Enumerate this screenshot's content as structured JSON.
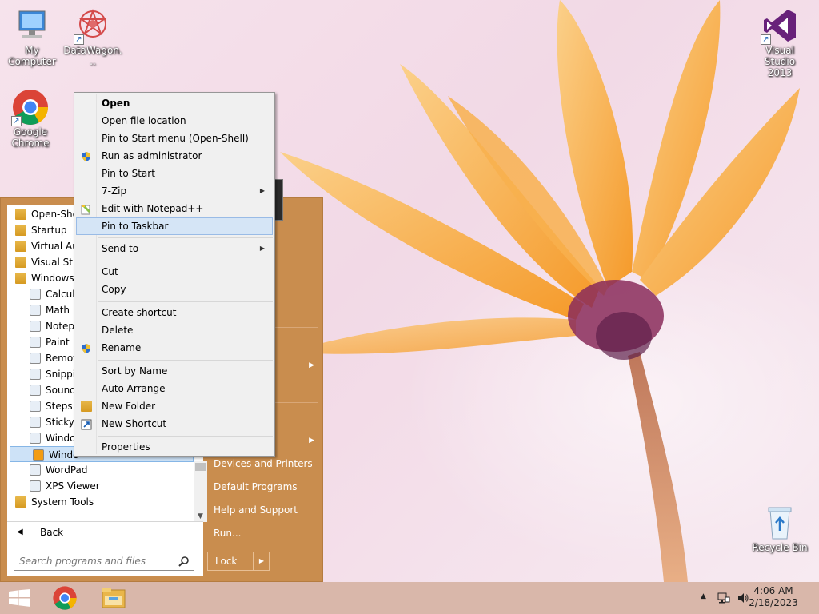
{
  "desktop": {
    "icons": [
      {
        "label": "My Computer"
      },
      {
        "label": "DataWagon..."
      },
      {
        "label": "Google Chrome"
      },
      {
        "label": "Visual Studio 2013"
      },
      {
        "label": "Recycle Bin"
      }
    ]
  },
  "start_menu": {
    "programs": [
      {
        "label": "Open-She",
        "icon": "folder-icon"
      },
      {
        "label": "Startup",
        "icon": "folder-icon"
      },
      {
        "label": "Virtual Au",
        "icon": "folder-icon"
      },
      {
        "label": "Visual Stu",
        "icon": "folder-icon"
      },
      {
        "label": "Windows",
        "icon": "folder-icon"
      },
      {
        "label": "Calcul",
        "icon": "calculator-icon"
      },
      {
        "label": "Math I",
        "icon": "math-input-icon"
      },
      {
        "label": "Notepa",
        "icon": "notepad-icon"
      },
      {
        "label": "Paint",
        "icon": "paint-icon"
      },
      {
        "label": "Remot",
        "icon": "remote-desktop-icon"
      },
      {
        "label": "Snippin",
        "icon": "snipping-tool-icon"
      },
      {
        "label": "Sound",
        "icon": "sound-recorder-icon"
      },
      {
        "label": "Steps R",
        "icon": "steps-recorder-icon"
      },
      {
        "label": "Sticky",
        "icon": "sticky-notes-icon"
      },
      {
        "label": "Windo",
        "icon": "keyboard-icon"
      },
      {
        "label": "Windo",
        "icon": "media-player-icon"
      },
      {
        "label": "WordPad",
        "icon": "wordpad-icon"
      },
      {
        "label": "XPS Viewer",
        "icon": "xps-viewer-icon"
      },
      {
        "label": "System Tools",
        "icon": "folder-icon"
      }
    ],
    "back_label": "Back",
    "search_placeholder": "Search programs and files",
    "right_items": [
      {
        "label": "Devices and Printers"
      },
      {
        "label": "Default Programs"
      },
      {
        "label": "Help and Support"
      },
      {
        "label": "Run..."
      }
    ],
    "lock_label": "Lock"
  },
  "context_menu": {
    "items": [
      {
        "label": "Open"
      },
      {
        "label": "Open file location"
      },
      {
        "label": "Pin to Start menu (Open-Shell)"
      },
      {
        "label": "Run as administrator",
        "icon": "uac-shield-icon"
      },
      {
        "label": "Pin to Start"
      },
      {
        "label": "7-Zip"
      },
      {
        "label": "Edit with Notepad++",
        "icon": "notepad-plus-plus-icon"
      },
      {
        "label": "Pin to Taskbar"
      },
      {
        "label": "Send to"
      },
      {
        "label": "Cut"
      },
      {
        "label": "Copy"
      },
      {
        "label": "Create shortcut"
      },
      {
        "label": "Delete"
      },
      {
        "label": "Rename",
        "icon": "uac-shield-icon"
      },
      {
        "label": "Sort by Name"
      },
      {
        "label": "Auto Arrange"
      },
      {
        "label": "New Folder",
        "icon": "folder-icon"
      },
      {
        "label": "New Shortcut",
        "icon": "shortcut-icon"
      },
      {
        "label": "Properties"
      }
    ]
  },
  "taskbar": {
    "time": "4:06 AM",
    "date": "2/18/2023"
  },
  "colors": {
    "start_menu_bg": "#c98d4e",
    "highlight": "#cde2f7",
    "taskbar_bg": "#d9b7aa",
    "flower": "#f6a83e"
  }
}
